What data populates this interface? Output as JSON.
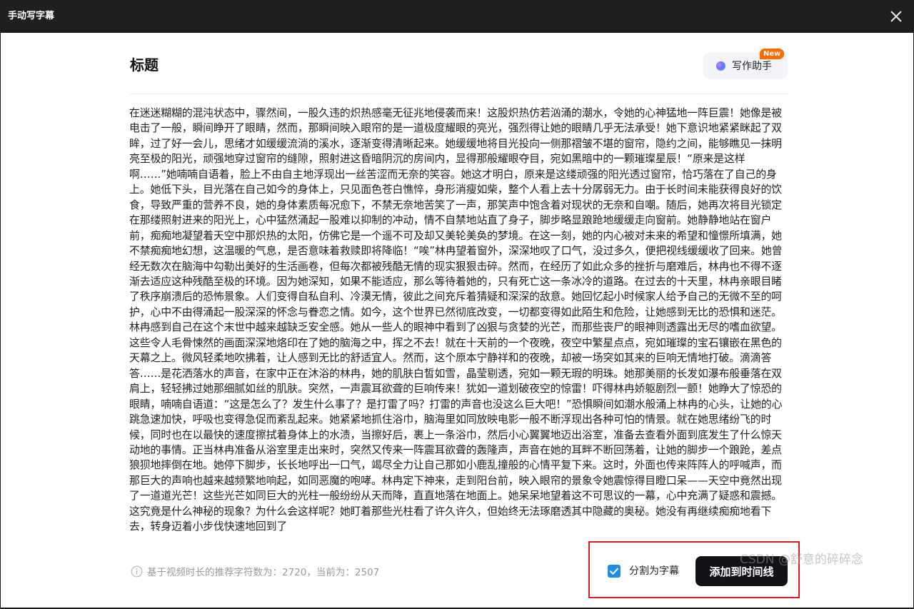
{
  "window": {
    "title": "手动写字幕"
  },
  "editor": {
    "title": "标题",
    "assistant_label": "写作助手",
    "assistant_badge": "New",
    "content": "在迷迷糊糊的混沌状态中，骤然间，一股久违的炽热感毫无征兆地侵袭而来！这股炽热仿若汹涌的潮水，令她的心神猛地一阵巨震！她像是被电击了一般，瞬间睁开了眼睛，然而，那瞬间映入眼帘的是一道极度耀眼的亮光，强烈得让她的眼睛几乎无法承受！她下意识地紧紧眯起了双眸，过了好一会儿，思绪才如缓缓流淌的溪水，逐渐变得清晰起来。她缓缓地将目光投向一侧那褶皱不堪的窗帘，隐约之间，能够瞧见一抹明亮至极的阳光，顽强地穿过窗帘的缝隙，照射进这昏暗阴沉的房间内，显得那般耀眼夺目，宛如黑暗中的一颗璀璨星辰！“原来是这样啊……”她喃喃自语着，脸上不由自主地浮现出一丝苦涩而无奈的笑容。她这才明白，原来是这缕顽强的阳光透过窗帘，恰巧落在了自己的身上。她低下头，目光落在自己如今的身体上，只见面色苍白憔悴，身形消瘦如柴，整个人看上去十分孱弱无力。由于长时间未能获得良好的饮食，导致严重的营养不良，她的身体素质每况愈下，不禁无奈地苦笑了一声，那笑声中饱含着对现状的无奈和自嘲。随后，她再次将目光锁定在那缕照射进来的阳光上，心中猛然涌起一股难以抑制的冲动，情不自禁地站直了身子，脚步略显踉跄地缓缓走向窗前。她静静地站在窗户前，痴痴地凝望着天空中那炽热的太阳，仿佛它是一个遥不可及却又美轮美奂的梦境。在这一刻，她的内心被对未来的希望和憧憬所填满，她不禁痴痴地幻想，这温暖的气息，是否意味着救赎即将降临！“唉”林冉望着窗外，深深地叹了口气，没过多久，便把视线缓缓收了回来。她曾经无数次在脑海中勾勒出美好的生活画卷，但每次都被残酷无情的现实狠狠击碎。然而，在经历了如此众多的挫折与磨难后，林冉也不得不逐渐去适应这种残酷至极的环境。因为她深知，如果不能适应，那么等待着她的，只有死亡这一条冰冷的道路。在过去的十天里，林冉亲眼目睹了秩序崩溃后的恐怖景象。人们变得自私自利、冷漠无情，彼此之间充斥着猜疑和深深的敌意。她回忆起小时候家人给予自己的无微不至的呵护，心中不由得涌起一股深深的怀念与眷恋之情。如今，这个世界已然彻底改变，一切都变得如此陌生和危险，让她感到无比的恐惧和迷茫。林冉感到自己在这个末世中越来越缺乏安全感。她从一些人的眼神中看到了凶狠与贪婪的光芒，而那些丧尸的眼神则透露出无尽的嗜血欲望。这些令人毛骨悚然的画面深深地烙印在了她的脑海之中，挥之不去！就在十天前的一个夜晚，夜空中繁星点点，宛如璀璨的宝石镶嵌在黑色的天幕之上。微风轻柔地吹拂着，让人感到无比的舒适宜人。然而，这个原本宁静祥和的夜晚，却被一场突如其来的巨响无情地打破。滴滴答答……是花洒落水的声音，在家中正在沐浴的林冉，她的肌肤白皙如雪，晶莹剔透，宛如一颗无瑕的明珠。她那美丽的长发如瀑布般垂落在双肩上，轻轻拂过她那细腻如丝的肌肤。突然，一声震耳欲聋的巨响传来！犹如一道划破夜空的惊雷！吓得林冉娇躯剧烈一颤！她睁大了惊恐的眼睛，喃喃自语道：“这是怎么了？发生什么事了？是打雷了吗？打雷的声音也没这么巨大吧！”恐惧瞬间如潮水般涌上林冉的心头，让她的心跳急速加快，呼吸也变得急促而紊乱起来。她紧紧地抓住浴巾，脑海里如同放映电影一般不断浮现出各种可怕的情景。就在她思绪纷飞的时候，同时也在以最快的速度擦拭着身体上的水渍，当擦好后，裹上一条浴巾，然后小心翼翼地迈出浴室，准备去查看外面到底发生了什么惊天动地的事情。正当林冉准备从浴室里走出来时，突然又传来一阵震耳欲聋的轰隆声，声音在她的耳畔不断回荡着，让她的脚步一个踉跄，差点狼狈地摔倒在地。她停下脚步，长长地呼出一口气，竭尽全力让自己那如小鹿乱撞般的心情平复下来。这时，外面也传来阵阵人的呼喊声，而那巨大的声响也越来越频繁地响起，如同恶魔的咆哮。林冉定下神来，走到阳台前，映入眼帘的景象令她震惊得目瞪口呆——天空中竟然出现了一道道光芒！这些光芒如同巨大的光柱一般纷纷从天而降，直直地落在地面上。她呆呆地望着这不可思议的一幕，心中充满了疑惑和震撼。这究竟是什么神秘的现象？为什么会这样呢？她盯着那些光柱看了许久许久，但始终无法琢磨透其中隐藏的奥秘。她没有再继续痴痴地看下去，转身迈着小步伐快速地回到了"
  },
  "footer": {
    "info_text": "基于视频时长的推荐字符数为：2720，当前为：2507",
    "split_label": "分割为字幕",
    "split_checked": true,
    "add_button_label": "添加到时间线"
  },
  "watermark": "CSDN @舒意的碎碎念",
  "colors": {
    "accent_blue": "#1a8ee8",
    "badge_orange": "#ff6a00",
    "highlight_red": "#e0191e",
    "primary_button": "#111318"
  }
}
